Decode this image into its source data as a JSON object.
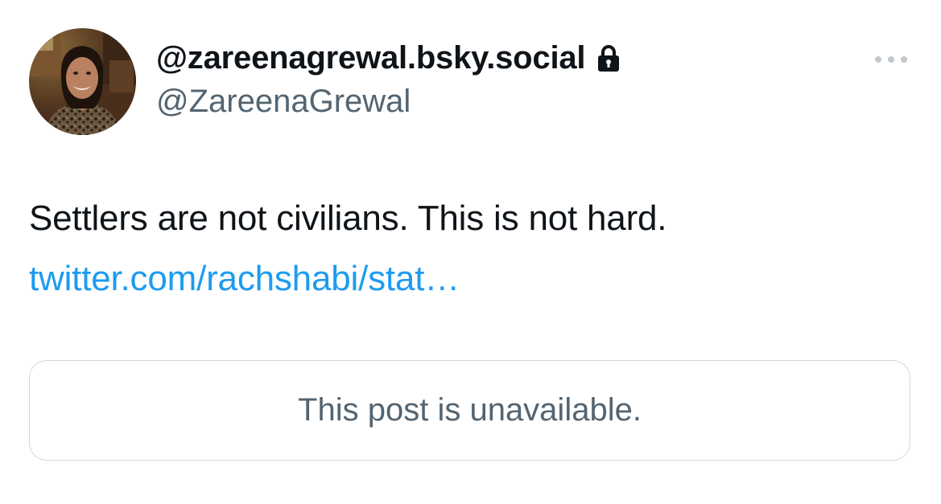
{
  "tweet": {
    "display_name": "@zareenagrewal.bsky.social",
    "handle": "@ZareenaGrewal",
    "body": "Settlers are not civilians. This is not hard.",
    "link_text": "twitter.com/rachshabi/stat…",
    "quoted_post_notice": "This post is unavailable."
  },
  "icons": {
    "protected_account": "lock-icon",
    "more_options": "more-horizontal-icon",
    "avatar": "profile-photo"
  },
  "colors": {
    "text_primary": "#0f1419",
    "text_secondary": "#536471",
    "link": "#1d9bf0",
    "border": "#cfd9de"
  }
}
